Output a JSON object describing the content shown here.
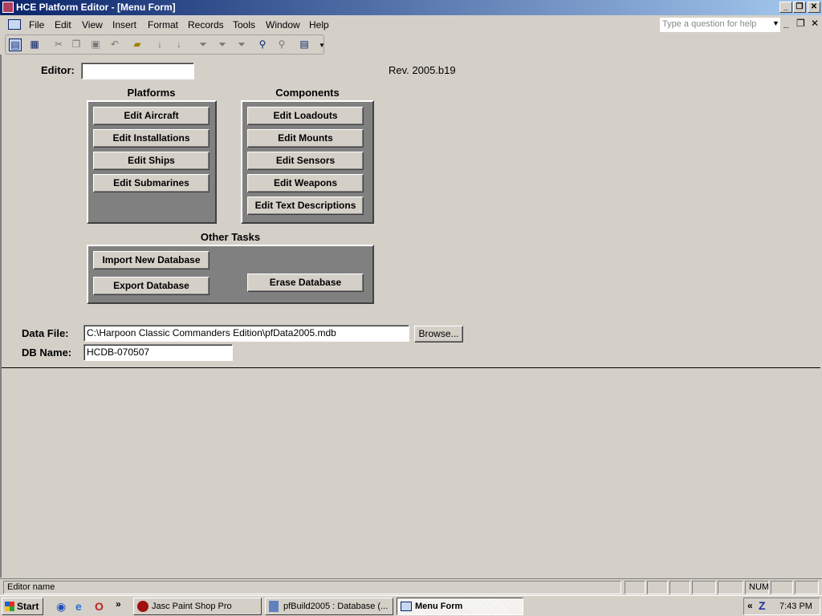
{
  "window": {
    "title": "HCE Platform Editor - [Menu Form]"
  },
  "menu": [
    "File",
    "Edit",
    "View",
    "Insert",
    "Format",
    "Records",
    "Tools",
    "Window",
    "Help"
  ],
  "help_placeholder": "Type a question for help",
  "form": {
    "editor_label": "Editor:",
    "editor_value": "",
    "revision": "Rev. 2005.b19",
    "platforms_heading": "Platforms",
    "platforms": [
      "Edit Aircraft",
      "Edit Installations",
      "Edit Ships",
      "Edit Submarines"
    ],
    "components_heading": "Components",
    "components": [
      "Edit Loadouts",
      "Edit Mounts",
      "Edit Sensors",
      "Edit Weapons",
      "Edit Text Descriptions"
    ],
    "other_heading": "Other Tasks",
    "import": "Import New Database",
    "export": "Export Database",
    "erase": "Erase Database",
    "datafile_label": "Data File:",
    "datafile_value": "C:\\Harpoon Classic Commanders Edition\\pfData2005.mdb",
    "browse": "Browse...",
    "dbname_label": "DB Name:",
    "dbname_value": "HCDB-070507"
  },
  "status": {
    "text": "Editor name",
    "num": "NUM"
  },
  "taskbar": {
    "start": "Start",
    "tasks": [
      "Jasc Paint Shop Pro",
      "pfBuild2005 : Database (...",
      "Menu Form"
    ],
    "clock": "7:43 PM"
  }
}
